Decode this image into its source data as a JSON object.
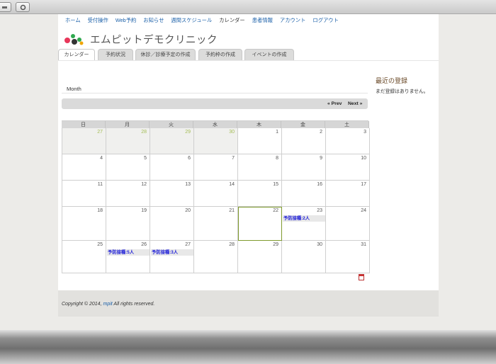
{
  "nav": {
    "items": [
      "ホーム",
      "受付操作",
      "Web予約",
      "お知らせ",
      "週間スケジュール",
      "カレンダー",
      "患者情報",
      "アカウント",
      "ログアウト"
    ],
    "current_index": 5
  },
  "site": {
    "title": "エムピットデモクリニック"
  },
  "tabs": [
    "カレンダー",
    "予約状況",
    "休診／診療予定の作成",
    "予約枠の作成",
    "イベントの作成"
  ],
  "calendar": {
    "view_label": "Month",
    "prev_label": "« Prev",
    "next_label": "Next »",
    "weekdays": [
      "日",
      "月",
      "火",
      "水",
      "木",
      "金",
      "土"
    ],
    "weeks": [
      [
        {
          "day": "27",
          "other": true
        },
        {
          "day": "28",
          "other": true
        },
        {
          "day": "29",
          "other": true
        },
        {
          "day": "30",
          "other": true
        },
        {
          "day": "1"
        },
        {
          "day": "2"
        },
        {
          "day": "3"
        }
      ],
      [
        {
          "day": "4"
        },
        {
          "day": "5"
        },
        {
          "day": "6"
        },
        {
          "day": "7"
        },
        {
          "day": "8"
        },
        {
          "day": "9"
        },
        {
          "day": "10"
        }
      ],
      [
        {
          "day": "11"
        },
        {
          "day": "12"
        },
        {
          "day": "13"
        },
        {
          "day": "14"
        },
        {
          "day": "15"
        },
        {
          "day": "16"
        },
        {
          "day": "17"
        }
      ],
      [
        {
          "day": "18"
        },
        {
          "day": "19"
        },
        {
          "day": "20"
        },
        {
          "day": "21"
        },
        {
          "day": "22",
          "today": true
        },
        {
          "day": "23",
          "event": "予防接種:2人"
        },
        {
          "day": "24"
        }
      ],
      [
        {
          "day": "25"
        },
        {
          "day": "26",
          "event": "予防接種:5人"
        },
        {
          "day": "27",
          "event": "予防接種:3人"
        },
        {
          "day": "28"
        },
        {
          "day": "29"
        },
        {
          "day": "30"
        },
        {
          "day": "31"
        }
      ]
    ]
  },
  "sidebar": {
    "title": "最近の登録",
    "empty_text": "まだ登録はありません。"
  },
  "footer": {
    "copyright": "Copyright © 2014,",
    "company": "mpit",
    "rights": "All rights reserved."
  },
  "colors": {
    "link": "#1a5fa8",
    "event_text": "#1b1bd8",
    "other_month_day": "#a4bd55",
    "today_border": "#7f9a2e"
  },
  "icons": [
    "window-control-icon",
    "window-control-icon",
    "clinic-logo-icon",
    "ical-export-icon"
  ]
}
